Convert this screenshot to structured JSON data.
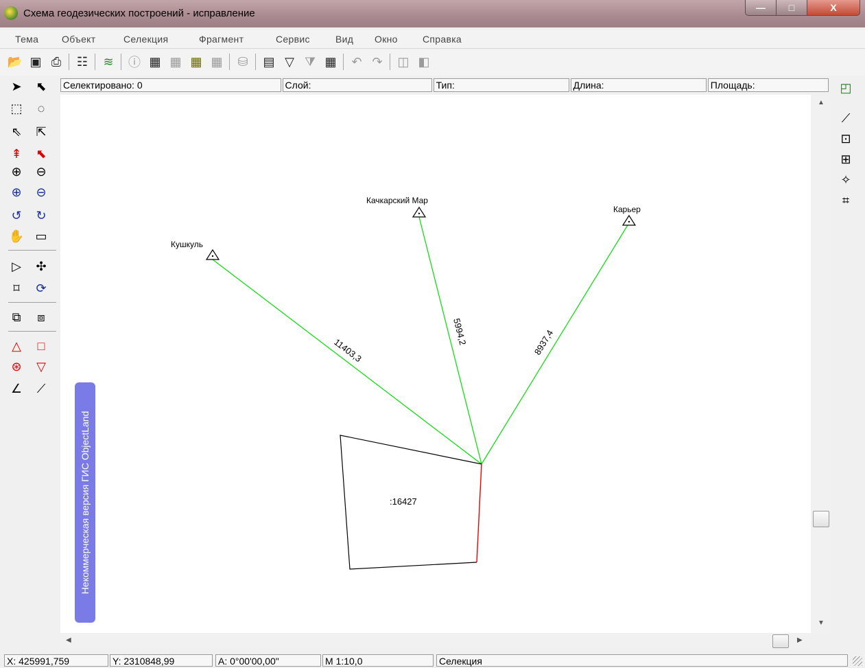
{
  "window": {
    "title": "Схема геодезических построений - исправление",
    "controls": {
      "minimize": "—",
      "maximize": "□",
      "close": "X"
    }
  },
  "menu": [
    "Тема",
    "Объект",
    "Селекция",
    "Фрагмент",
    "Сервис",
    "Вид",
    "Окно",
    "Справка"
  ],
  "toolbar_icons": [
    "open-folder-icon",
    "save-disk-icon",
    "print-icon",
    "properties-icon",
    "layers-icon",
    "info-icon",
    "table-icon",
    "table-link-icon",
    "table-yellow-icon",
    "table-gray-icon",
    "database-icon",
    "form-icon",
    "filter-icon",
    "filter-clear-icon",
    "grid-icon",
    "undo-link-icon",
    "redo-link-icon",
    "window-back-icon",
    "window-forward-icon"
  ],
  "info_panel": {
    "selected": "Селектировано: 0",
    "layer": "Слой:",
    "type": "Тип:",
    "length": "Длина:",
    "area": "Площадь:"
  },
  "map": {
    "stations": [
      {
        "name": "Кушкуль"
      },
      {
        "name": "Качкарский Мар"
      },
      {
        "name": "Карьер"
      }
    ],
    "distances": [
      "11403,3",
      "5994,2",
      "8937,4"
    ],
    "parcel_label": ":16427",
    "colors": {
      "rays": "#00dd00",
      "boundary": "#000000",
      "highlighted_edge": "#ee0000"
    }
  },
  "watermark": "Некоммерческая версия ГИС ObjectLand",
  "status": {
    "x": "X: 425991,759",
    "y": "Y: 2310848,99",
    "angle": "A:   0°00'00,00\"",
    "scale": "M 1:10,0",
    "mode": "Селекция"
  }
}
